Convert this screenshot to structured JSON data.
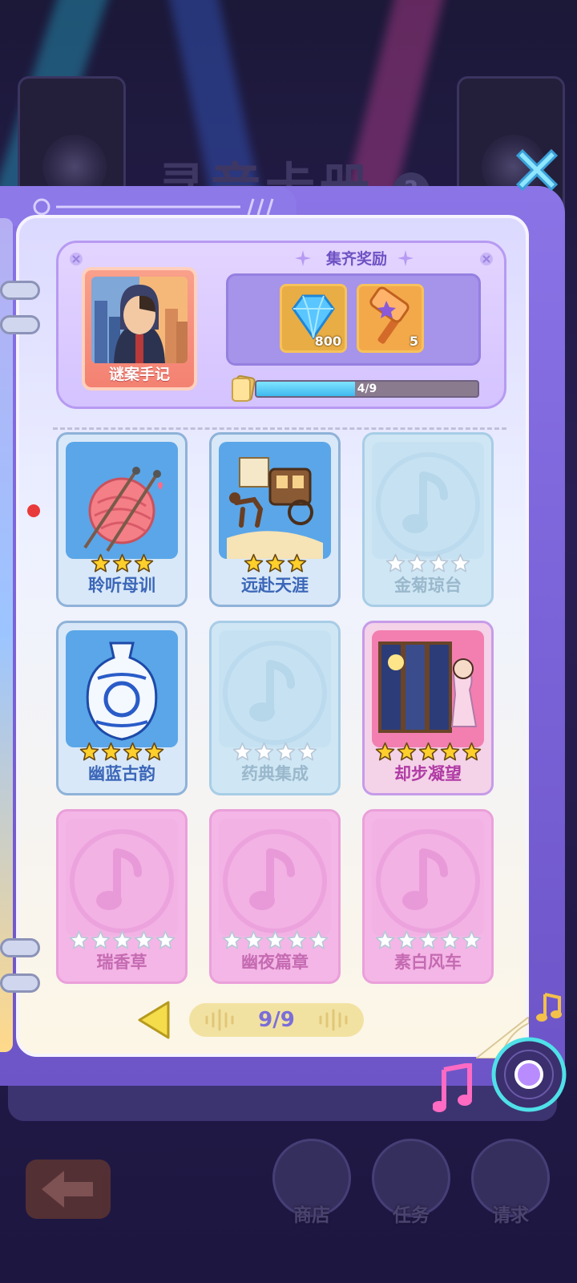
{
  "background_title": "寻音卡册",
  "reward": {
    "title": "集齐奖励",
    "album_name": "谜案手记",
    "items": [
      {
        "icon": "diamond-icon",
        "qty": "800"
      },
      {
        "icon": "hammer-icon",
        "qty": "5"
      }
    ],
    "progress_text": "4/9",
    "progress_fraction": 0.444
  },
  "cards": [
    {
      "name": "聆听母训",
      "stars": 3,
      "max_stars": 3,
      "state": "unlocked",
      "art": "yarn-ball-icon"
    },
    {
      "name": "远赴天涯",
      "stars": 3,
      "max_stars": 3,
      "state": "unlocked",
      "art": "carriage-icon"
    },
    {
      "name": "金菊琼台",
      "stars": 0,
      "max_stars": 4,
      "state": "locked",
      "art": "music-note-icon"
    },
    {
      "name": "幽蓝古韵",
      "stars": 4,
      "max_stars": 4,
      "state": "unlocked",
      "art": "porcelain-vase-icon"
    },
    {
      "name": "药典集成",
      "stars": 0,
      "max_stars": 4,
      "state": "locked",
      "art": "music-note-icon"
    },
    {
      "name": "却步凝望",
      "stars": 5,
      "max_stars": 5,
      "state": "unlocked-gold",
      "art": "folding-screen-icon"
    },
    {
      "name": "瑞香草",
      "stars": 0,
      "max_stars": 5,
      "state": "locked-pink",
      "art": "music-note-icon"
    },
    {
      "name": "幽夜篇章",
      "stars": 0,
      "max_stars": 5,
      "state": "locked-pink",
      "art": "music-note-icon"
    },
    {
      "name": "素白风车",
      "stars": 0,
      "max_stars": 5,
      "state": "locked-pink",
      "art": "music-note-icon"
    }
  ],
  "pagination": {
    "text": "9/9"
  },
  "bottom_bar": {
    "shop_label": "商店",
    "tasks_label": "任务",
    "requests_label": "请求"
  },
  "colors": {
    "unlocked_label": "#3b66b8",
    "locked_label": "#9ab8cc",
    "pink_label": "#c56bb2",
    "gold_label": "#b03aa4",
    "star_gold": "#ffcf2b",
    "star_empty": "#ffffff"
  }
}
